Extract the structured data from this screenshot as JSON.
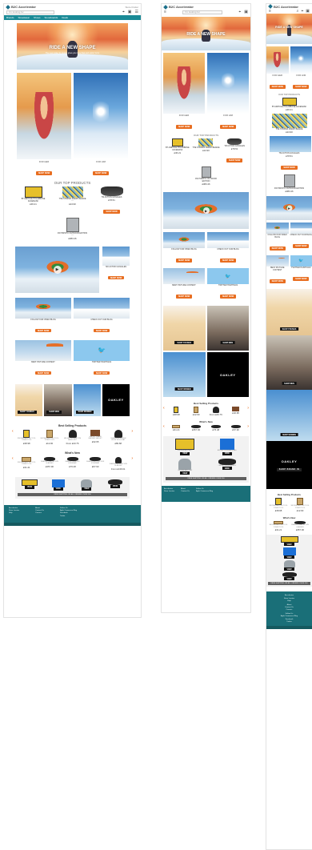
{
  "site": {
    "brand": "B2C Accelerator",
    "header_link": "Store Finder",
    "search_placeholder": "I'm looking for",
    "nav_items": [
      "Brands",
      "Streetwear",
      "Shoes",
      "Snowboards",
      "Deals"
    ],
    "hero_title": "RIDE A NEW SHAPE",
    "hero_subtitle": "The new rocker tip design gives you more float and easier turns"
  },
  "ride_section": {
    "items": [
      {
        "caption": "FOR HER",
        "button": "SHOP NOW"
      },
      {
        "caption": "FOR HIM",
        "button": "SHOP NOW"
      }
    ]
  },
  "top_products": {
    "title": "OUR TOP PRODUCTS",
    "items": [
      {
        "name": "BT AIRHOLE POLARBONE FACEMASK",
        "price": "£36.21",
        "img": "pad"
      },
      {
        "name": "THE STRIPES FRESH BEANIE",
        "price": "£24.90",
        "img": "stripe"
      },
      {
        "name": "TM ACTION GOGGLES",
        "price": "£78.51",
        "img": "goggle"
      },
      {
        "name": "FW HIRSTIC OUTDOOR EDITION",
        "price": "£383.46",
        "img": "cam"
      }
    ],
    "button": "SHOP NOW"
  },
  "blocks": [
    {
      "title": "SKI ACTION GOGGLES",
      "button": "SHOP NOW"
    },
    {
      "title": "FOLLOW OUR VIDEO BLOG",
      "button": "SHOP NOW"
    },
    {
      "title": "CHECK OUT OUR BLOG",
      "button": "SHOP NOW"
    },
    {
      "title": "BEST PICTURE CONTEST",
      "button": "SHOP NOW"
    },
    {
      "title": "TWITTER HASHTAGS",
      "button": "SHOP NOW"
    }
  ],
  "shop_tiles": [
    "SHOP YOUNGS",
    "SHOP MEN",
    "SHOP WOMEN",
    "SHOP BRAND IN"
  ],
  "oakley_label": "OAKLEY",
  "best_selling": {
    "title": "Best Selling Products",
    "items": [
      {
        "name": "SNOWBOARD SKI TOOL TONER TOOL",
        "price": "£38.98",
        "img": "pad"
      },
      {
        "name": "SNOWBOARD SKI TOOL TONER TOOL",
        "price": "£12.90",
        "img": "bag"
      },
      {
        "name": "HELMET WOMEN TSM MADE UNIT",
        "price": "From £43.76",
        "img": "helmet"
      },
      {
        "name": "WALLET CHASE HARDER WALLET",
        "price": "£32.95",
        "img": "wallet"
      },
      {
        "name": "CHASER ALUMINUM SNOW WOOL HAT",
        "price": "£89.68",
        "img": "helmet"
      }
    ]
  },
  "whats_new": {
    "title": "What's New",
    "items": [
      {
        "name": "SNOWBOARD SKI TOOL TONER TOOL",
        "price": "£31.21",
        "img": "bag"
      },
      {
        "name": "SHADES CHAYNE SUN GLASSES",
        "price": "£357.90",
        "img": "shade"
      },
      {
        "name": "SHADES DIAMOND EYEWEAR",
        "price": "£76.48",
        "img": "shade"
      },
      {
        "name": "SHADES AROUND SUN EYEWEAR",
        "price": "£67.90",
        "img": "shade"
      },
      {
        "name": "SHADES AROUND SUN GLASSES",
        "price": "From £136.61",
        "img": "helmet"
      }
    ]
  },
  "promo": {
    "items": [
      {
        "label": "SNOWBOARD BELT",
        "button": "VIEW"
      },
      {
        "label": "ADIDAS ORIGINALS BAG",
        "button": "VIEW"
      },
      {
        "label": "SNOWBOARD CAP",
        "button": "VIEW"
      },
      {
        "label": "OAKLEY SUNGLASSES",
        "button": "VIEW"
      }
    ],
    "banner": "FREE SHIPPING ON ALL ORDERS OVER £50"
  },
  "footer": {
    "col1": [
      "Accelerator",
      "Store Locator",
      "Help"
    ],
    "col2": [
      "About",
      "Contact Us",
      "Careers"
    ],
    "col3": [
      "Follow Us",
      "Agile Commerce Blog",
      "Facebook",
      "Twitter"
    ]
  },
  "colors": {
    "accent": "#e86d1f",
    "nav": "#1a8a96",
    "footer": "#1a6f78"
  }
}
